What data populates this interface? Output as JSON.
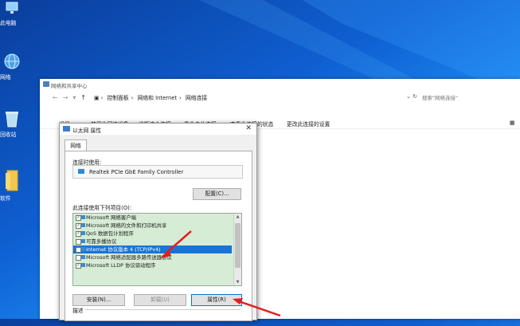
{
  "desktop": {
    "icons": [
      {
        "label": "此电脑",
        "icon": "computer-icon"
      },
      {
        "label": "网络",
        "icon": "network-globe-icon"
      },
      {
        "label": "回收站",
        "icon": "recycle-bin-icon"
      },
      {
        "label": "软件",
        "icon": "folder-icon"
      }
    ]
  },
  "explorer": {
    "title": "网络和共享中心",
    "address": {
      "items": [
        "控制面板",
        "网络和 Internet",
        "网络连接"
      ]
    },
    "search_placeholder": "搜索\"网络连接\"",
    "commands": [
      "组织▾",
      "禁用此网络设备",
      "诊断这个连接",
      "重命名此连接",
      "查看此连接的状态",
      "更改此连接的设置"
    ],
    "window_controls": {
      "minimize": "—",
      "maximize": "☐",
      "close": "✕"
    }
  },
  "dialog": {
    "title": "以太网 属性",
    "close": "✕",
    "tab": "网络",
    "connect_using_label": "连接时使用:",
    "adapter_name": "Realtek PCIe GbE Family Controller",
    "configure_button": "配置(C)...",
    "items_label": "此连接使用下列项目(O):",
    "items": [
      {
        "label": "Microsoft 网络客户端",
        "checked": true
      },
      {
        "label": "Microsoft 网络的文件和打印机共享",
        "checked": true
      },
      {
        "label": "QoS 数据包计划程序",
        "checked": true
      },
      {
        "label": "可靠多播协议",
        "checked": false
      },
      {
        "label": "Internet 协议版本 4 (TCP/IPv4)",
        "checked": true,
        "selected": true
      },
      {
        "label": "Microsoft 网络适配器多路传送器协议",
        "checked": false
      },
      {
        "label": "Microsoft LLDP 协议驱动程序",
        "checked": true
      }
    ],
    "install_button": "安装(N)...",
    "uninstall_button": "卸载(U)",
    "properties_button": "属性(R)",
    "description_label": "描述"
  },
  "colors": {
    "selection": "#1a73d6",
    "annotation_arrow": "#e02020",
    "desktop_blue": "#0f5fd1"
  }
}
